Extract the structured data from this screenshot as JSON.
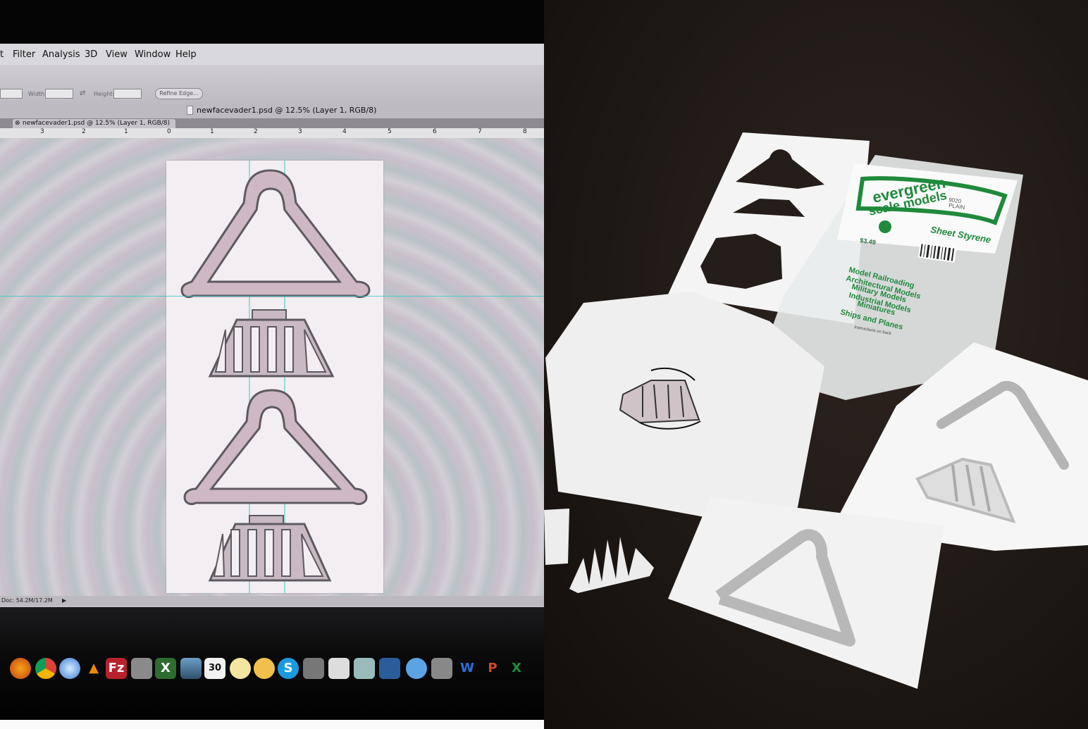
{
  "left_panel": {
    "menu": {
      "items": [
        "t",
        "Filter",
        "Analysis",
        "3D",
        "View",
        "Window",
        "Help"
      ]
    },
    "options_bar": {
      "width_label": "Width:",
      "height_label": "Height:",
      "refine_edge_label": "Refine Edge..."
    },
    "document": {
      "window_title": "newfacevader1.psd @ 12.5% (Layer 1, RGB/8)",
      "tab_label": "newfacevader1.psd @ 12.5% (Layer 1, RGB/8)",
      "ruler_ticks": [
        "3",
        "2",
        "1",
        "0",
        "1",
        "2",
        "3",
        "4",
        "5",
        "6",
        "7",
        "8"
      ],
      "status_text": "Doc: 54.2M/17.2M"
    },
    "dock": {
      "icons": [
        "firefox-icon",
        "chrome-icon",
        "safari-icon",
        "vlc-icon",
        "filezilla-icon",
        "scanner-icon",
        "crossover-icon",
        "preview-icon",
        "calendar-icon",
        "notes-icon",
        "stickies-icon",
        "skype-icon",
        "disk-utility-icon",
        "screenshot-icon",
        "archive-icon",
        "virtualbox-icon",
        "messages-icon",
        "printer-icon",
        "word-icon",
        "powerpoint-icon",
        "excel-icon"
      ],
      "calendar_day": "30"
    }
  },
  "right_panel": {
    "package": {
      "brand_line1": "evergreen",
      "brand_line2": "scale models",
      "product": "Sheet Styrene",
      "item_number": "9020",
      "finish": "PLAIN",
      "price": "$3.49",
      "uses": [
        "Model Railroading",
        "Architectural Models",
        "Military Models",
        "Industrial Models",
        "Miniatures",
        "Ships and Planes"
      ],
      "footer": "Instructions on back"
    }
  },
  "colors": {
    "shape_fill": "#c9b9c2",
    "shape_stroke": "#5d5a60",
    "guide": "#39c6c9",
    "brand_green": "#1f8a3b",
    "floor": "#221b17"
  }
}
